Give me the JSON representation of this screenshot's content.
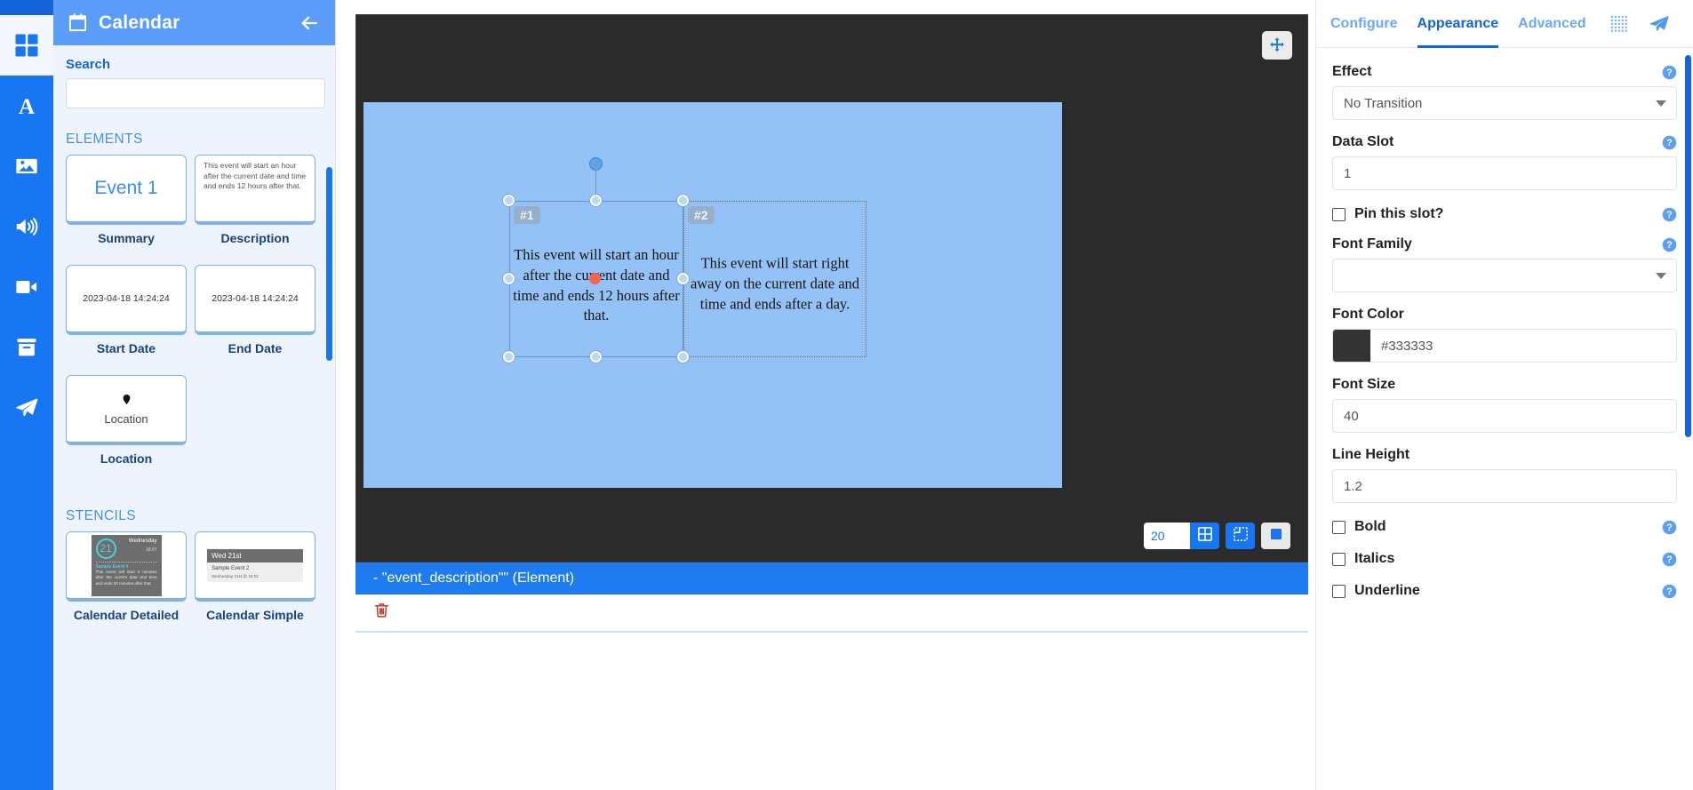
{
  "icon_rail": {
    "items": [
      {
        "name": "widgets-icon",
        "label": "Widgets",
        "active": true
      },
      {
        "name": "text-icon",
        "label": "Text",
        "active": false
      },
      {
        "name": "image-icon",
        "label": "Image",
        "active": false
      },
      {
        "name": "audio-icon",
        "label": "Audio",
        "active": false
      },
      {
        "name": "video-icon",
        "label": "Video",
        "active": false
      },
      {
        "name": "archive-icon",
        "label": "Archive",
        "active": false
      },
      {
        "name": "send-icon",
        "label": "Publish",
        "active": false
      }
    ]
  },
  "left_panel": {
    "title": "Calendar",
    "calendar_icon": "calendar-icon",
    "back_icon": "arrow-left-icon",
    "search": {
      "label": "Search",
      "value": "",
      "placeholder": ""
    },
    "elements_section": {
      "title": "ELEMENTS",
      "tiles": [
        {
          "label": "Summary",
          "kind": "summary",
          "preview": "Event 1"
        },
        {
          "label": "Description",
          "kind": "description",
          "preview": "This event will start an hour after the current date and time and ends 12 hours after that."
        },
        {
          "label": "Start Date",
          "kind": "date",
          "preview": "2023-04-18 14:24:24"
        },
        {
          "label": "End Date",
          "kind": "date",
          "preview": "2023-04-18 14:24:24"
        },
        {
          "label": "Location",
          "kind": "location",
          "preview": "Location"
        }
      ]
    },
    "stencils_section": {
      "title": "STENCILS",
      "tiles": [
        {
          "label": "Calendar Detailed",
          "kind": "detailed",
          "day_number": "21",
          "weekday": "Wednesday",
          "time": "18:07",
          "event_title": "Sample Event 4",
          "event_body": "This event will start 5 minutes after the current date and time and ends 30 minutes after that."
        },
        {
          "label": "Calendar Simple",
          "kind": "simple",
          "header": "Wed 21st",
          "line1": "Sample Event 2",
          "line2": "Wednesday 21st @ 18:02"
        }
      ]
    }
  },
  "canvas": {
    "move_handle_icon": "move-arrows-icon",
    "regions": [
      {
        "badge": "#1",
        "text": "This event will start an hour after the current date and time and ends 12 hours after that.",
        "selected": true
      },
      {
        "badge": "#2",
        "text": "This event will start right away on the current date and time and ends after a day.",
        "selected": false
      }
    ],
    "zoom_toolbar": {
      "zoom_value": "20",
      "buttons": [
        {
          "name": "grid-snap-icon",
          "state": "active"
        },
        {
          "name": "fit-selection-icon",
          "state": "active"
        },
        {
          "name": "fit-screen-icon",
          "state": "inactive"
        }
      ]
    },
    "status_text": "- \"event_description\"\" (Element)",
    "actions": [
      {
        "name": "delete-button",
        "icon": "trash-icon"
      }
    ]
  },
  "right_panel": {
    "tabs": [
      {
        "label": "Configure",
        "active": false
      },
      {
        "label": "Appearance",
        "active": true
      },
      {
        "label": "Advanced",
        "active": false
      }
    ],
    "tab_icons": [
      {
        "name": "grid-dots-icon"
      },
      {
        "name": "send-icon"
      }
    ],
    "fields": [
      {
        "type": "select",
        "label": "Effect",
        "value": "No Transition",
        "has_help": true,
        "name": "effect-select"
      },
      {
        "type": "text",
        "label": "Data Slot",
        "value": "1",
        "has_help": true,
        "name": "data-slot-input"
      },
      {
        "type": "checkbox",
        "label": "Pin this slot?",
        "checked": false,
        "has_help": true,
        "name": "pin-slot-checkbox"
      },
      {
        "type": "select",
        "label": "Font Family",
        "value": "",
        "has_help": true,
        "name": "font-family-select"
      },
      {
        "type": "color",
        "label": "Font Color",
        "value": "#333333",
        "swatch": "#333333",
        "has_help": false,
        "name": "font-color-input"
      },
      {
        "type": "text",
        "label": "Font Size",
        "value": "40",
        "has_help": false,
        "name": "font-size-input"
      },
      {
        "type": "text",
        "label": "Line Height",
        "value": "1.2",
        "has_help": false,
        "name": "line-height-input"
      },
      {
        "type": "checkbox",
        "label": "Bold",
        "checked": false,
        "has_help": true,
        "name": "bold-checkbox"
      },
      {
        "type": "checkbox",
        "label": "Italics",
        "checked": false,
        "has_help": true,
        "name": "italics-checkbox"
      },
      {
        "type": "checkbox",
        "label": "Underline",
        "checked": false,
        "has_help": true,
        "name": "underline-checkbox"
      }
    ]
  },
  "colors": {
    "accent": "#1976f2",
    "panel_header": "#5a9cf8",
    "canvas_bg": "#94c2f6",
    "stage_bg": "#2b2b2b",
    "status_bar": "#1e7cf0",
    "font_color": "#333333"
  }
}
